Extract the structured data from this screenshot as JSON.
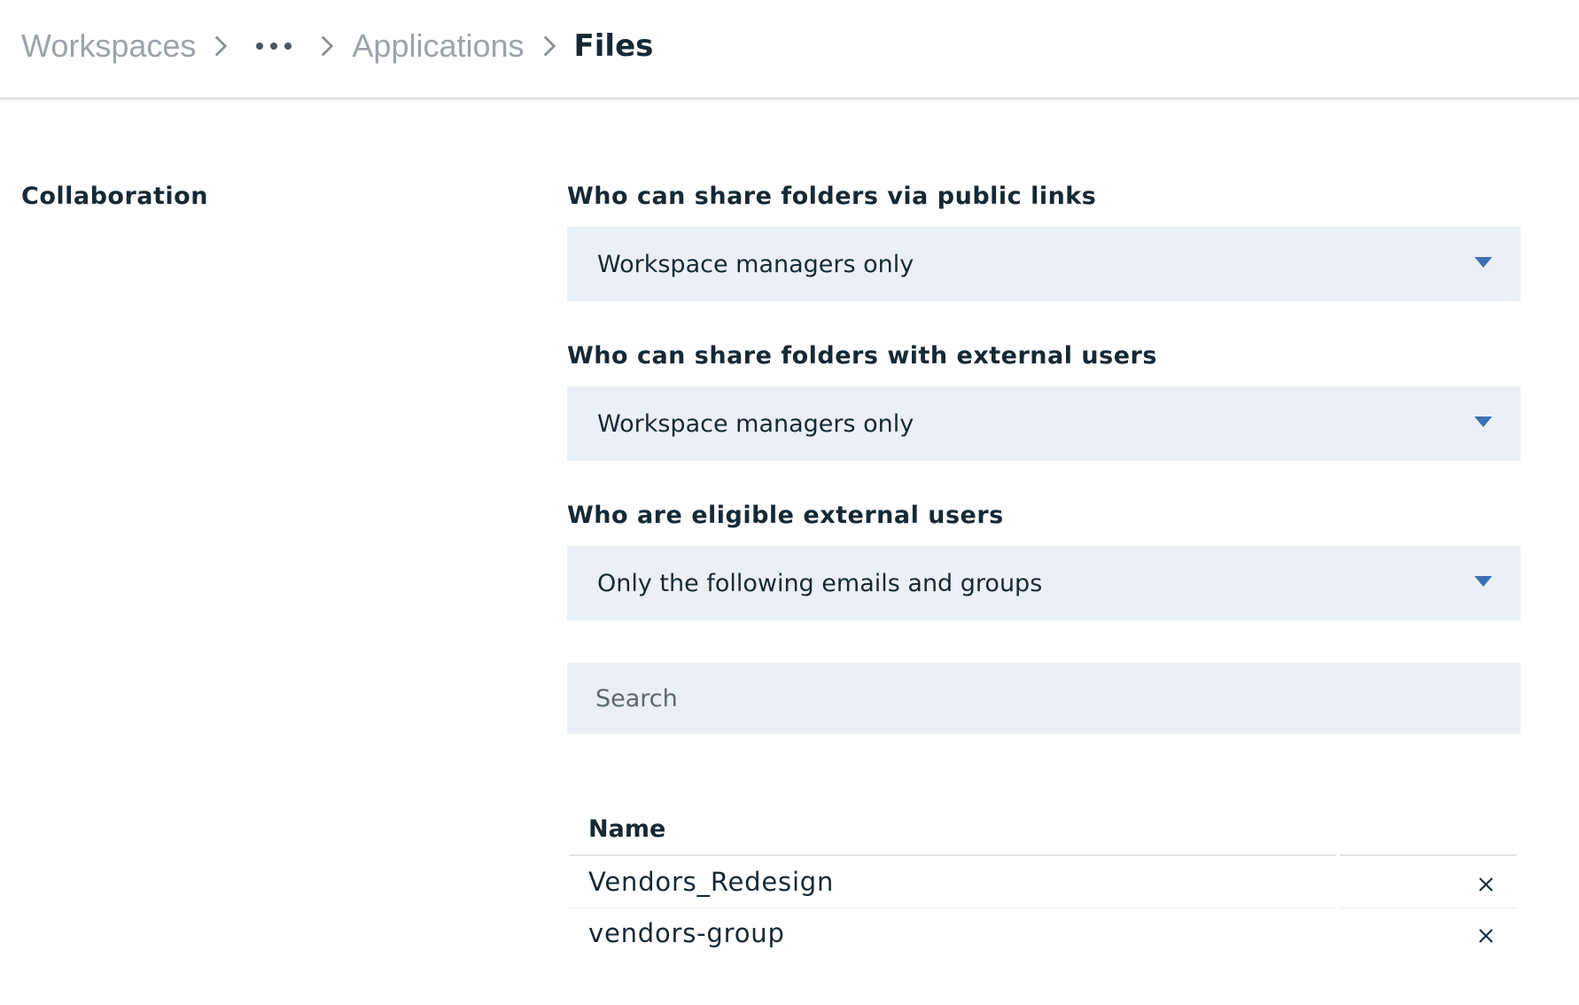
{
  "breadcrumb": {
    "items": [
      {
        "label": "Workspaces"
      },
      {
        "label": "Applications"
      }
    ],
    "current": "Files"
  },
  "section": {
    "title": "Collaboration"
  },
  "fields": {
    "public_links": {
      "label": "Who can share folders via public links",
      "value": "Workspace managers only"
    },
    "external_users": {
      "label": "Who can share folders with external users",
      "value": "Workspace managers only"
    },
    "eligible_users": {
      "label": "Who are eligible external users",
      "value": "Only the following emails and groups"
    }
  },
  "search": {
    "placeholder": "Search"
  },
  "table": {
    "column": "Name",
    "rows": [
      {
        "name": "Vendors_Redesign"
      },
      {
        "name": "vendors-group"
      }
    ]
  },
  "colors": {
    "input_bg": "#ebf0f7",
    "caret": "#3d70b2",
    "text": "#152935",
    "muted": "#9da3a8"
  },
  "icons": {
    "separator": "chevron-right-icon",
    "overflow": "overflow-menu-icon",
    "caret": "caret-down-icon",
    "remove": "close-icon"
  }
}
